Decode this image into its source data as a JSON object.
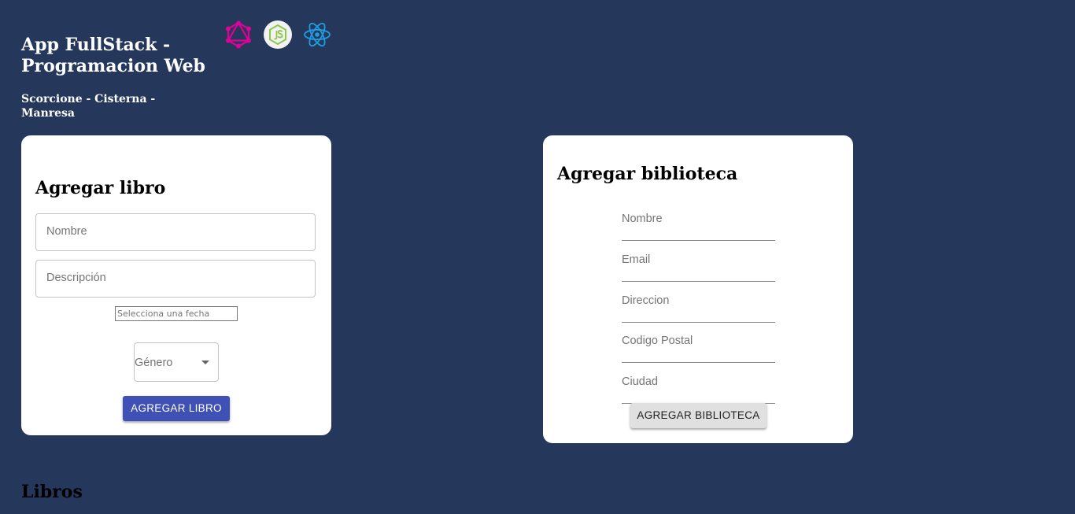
{
  "header": {
    "title": "App FullStack - Programacion Web",
    "subtitle": "Scorcione - Cisterna - Manresa",
    "logos": [
      {
        "name": "graphql-icon",
        "color": "#e10098"
      },
      {
        "name": "nodejs-icon",
        "color": "#8cc84b"
      },
      {
        "name": "react-icon",
        "color": "#61dafb"
      }
    ]
  },
  "libro_form": {
    "title": "Agregar libro",
    "nombre_placeholder": "Nombre",
    "descripcion_placeholder": "Descripción",
    "fecha_placeholder": "Selecciona una fecha",
    "genero_label": "Género",
    "submit_label": "AGREGAR LIBRO",
    "submit_color": "#3f51b5"
  },
  "biblioteca_form": {
    "title": "Agregar biblioteca",
    "fields": {
      "nombre": "Nombre",
      "email": "Email",
      "direccion": "Direccion",
      "codigo_postal": "Codigo Postal",
      "ciudad": "Ciudad"
    },
    "submit_label": "AGREGAR BIBLIOTECA"
  },
  "libros_section": {
    "title": "Libros"
  },
  "colors": {
    "background": "#25375b",
    "card": "#ffffff"
  }
}
